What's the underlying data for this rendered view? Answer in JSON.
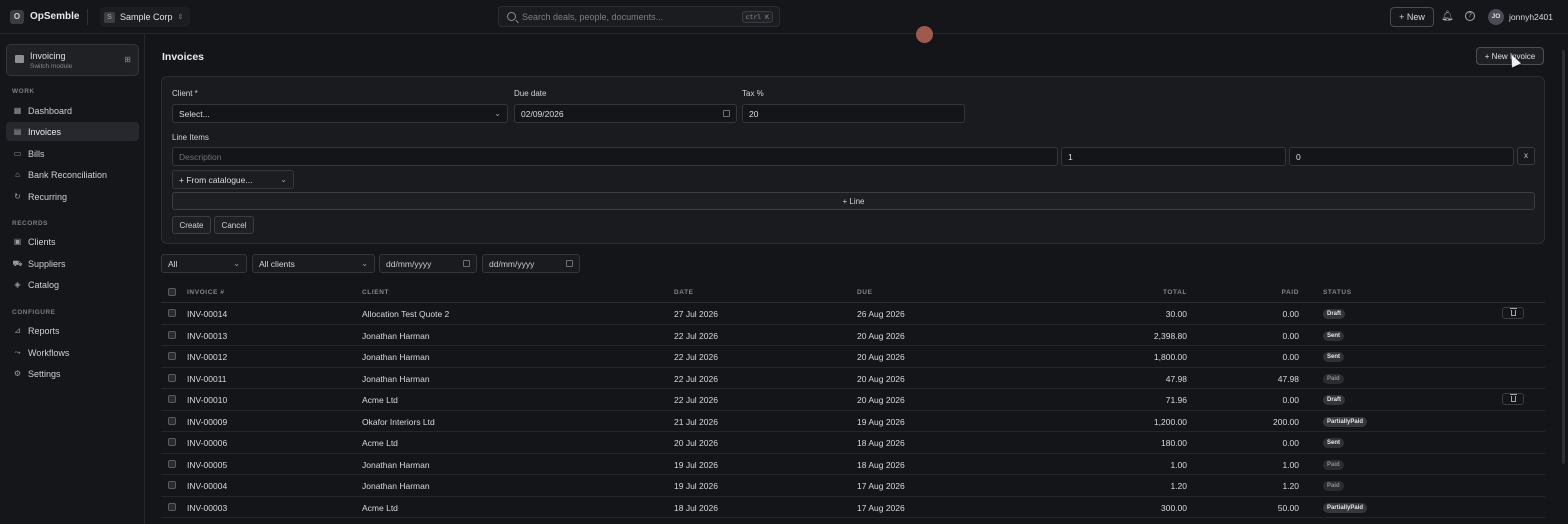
{
  "app": {
    "brand": "OpSemble",
    "logo": "O",
    "org": "Sample Corp",
    "org_icon": "S"
  },
  "search": {
    "placeholder": "Search deals, people, documents...",
    "shortcut": "ctrl K"
  },
  "topbar": {
    "new_label": "+ New",
    "user_initials": "JO",
    "username": "jonnyh2401"
  },
  "module": {
    "title": "Invoicing",
    "subtitle": "Switch module"
  },
  "sidebar": {
    "sections": [
      {
        "label": "WORK",
        "items": [
          {
            "label": "Dashboard",
            "icon": "grid-icon"
          },
          {
            "label": "Invoices",
            "icon": "file-icon",
            "active": true
          },
          {
            "label": "Bills",
            "icon": "receipt-icon"
          },
          {
            "label": "Bank Reconciliation",
            "icon": "bank-icon"
          },
          {
            "label": "Recurring",
            "icon": "repeat-icon"
          }
        ]
      },
      {
        "label": "RECORDS",
        "items": [
          {
            "label": "Clients",
            "icon": "users-icon"
          },
          {
            "label": "Suppliers",
            "icon": "truck-icon"
          },
          {
            "label": "Catalog",
            "icon": "box-icon"
          }
        ]
      },
      {
        "label": "CONFIGURE",
        "items": [
          {
            "label": "Reports",
            "icon": "chart-icon"
          },
          {
            "label": "Workflows",
            "icon": "workflow-icon"
          },
          {
            "label": "Settings",
            "icon": "gear-icon"
          }
        ]
      }
    ]
  },
  "page": {
    "title": "Invoices",
    "new_invoice_label": "+ New Invoice"
  },
  "form": {
    "client_label": "Client *",
    "client_value": "Select...",
    "due_label": "Due date",
    "due_value": "02/09/2026",
    "tax_label": "Tax %",
    "tax_value": "20",
    "line_items_label": "Line Items",
    "description_placeholder": "Description",
    "qty_value": "1",
    "price_value": "0",
    "remove_label": "x",
    "catalogue_label": "+ From catalogue...",
    "add_line_label": "+ Line",
    "create_label": "Create",
    "cancel_label": "Cancel"
  },
  "filters": {
    "status": "All",
    "client": "All clients",
    "from_placeholder": "dd/mm/yyyy",
    "to_placeholder": "dd/mm/yyyy"
  },
  "table": {
    "headers": {
      "invoice": "INVOICE #",
      "client": "CLIENT",
      "date": "DATE",
      "due": "DUE",
      "total": "TOTAL",
      "paid": "PAID",
      "status": "STATUS"
    },
    "rows": [
      {
        "invoice": "INV-00014",
        "client": "Allocation Test Quote 2",
        "date": "27 Jul 2026",
        "due": "26 Aug 2026",
        "total": "30.00",
        "paid": "0.00",
        "status": "Draft",
        "kind": "draft",
        "deletable": true
      },
      {
        "invoice": "INV-00013",
        "client": "Jonathan Harman",
        "date": "22 Jul 2026",
        "due": "20 Aug 2026",
        "total": "2,398.80",
        "paid": "0.00",
        "status": "Sent",
        "kind": "sent"
      },
      {
        "invoice": "INV-00012",
        "client": "Jonathan Harman",
        "date": "22 Jul 2026",
        "due": "20 Aug 2026",
        "total": "1,800.00",
        "paid": "0.00",
        "status": "Sent",
        "kind": "sent"
      },
      {
        "invoice": "INV-00011",
        "client": "Jonathan Harman",
        "date": "22 Jul 2026",
        "due": "20 Aug 2026",
        "total": "47.98",
        "paid": "47.98",
        "status": "Paid",
        "kind": "paid"
      },
      {
        "invoice": "INV-00010",
        "client": "Acme Ltd",
        "date": "22 Jul 2026",
        "due": "20 Aug 2026",
        "total": "71.96",
        "paid": "0.00",
        "status": "Draft",
        "kind": "draft",
        "deletable": true
      },
      {
        "invoice": "INV-00009",
        "client": "Okafor Interiors Ltd",
        "date": "21 Jul 2026",
        "due": "19 Aug 2026",
        "total": "1,200.00",
        "paid": "200.00",
        "status": "PartiallyPaid",
        "kind": "partial"
      },
      {
        "invoice": "INV-00006",
        "client": "Acme Ltd",
        "date": "20 Jul 2026",
        "due": "18 Aug 2026",
        "total": "180.00",
        "paid": "0.00",
        "status": "Sent",
        "kind": "sent"
      },
      {
        "invoice": "INV-00005",
        "client": "Jonathan Harman",
        "date": "19 Jul 2026",
        "due": "18 Aug 2026",
        "total": "1.00",
        "paid": "1.00",
        "status": "Paid",
        "kind": "paid"
      },
      {
        "invoice": "INV-00004",
        "client": "Jonathan Harman",
        "date": "19 Jul 2026",
        "due": "17 Aug 2026",
        "total": "1.20",
        "paid": "1.20",
        "status": "Paid",
        "kind": "paid"
      },
      {
        "invoice": "INV-00003",
        "client": "Acme Ltd",
        "date": "18 Jul 2026",
        "due": "17 Aug 2026",
        "total": "300.00",
        "paid": "50.00",
        "status": "PartiallyPaid",
        "kind": "partial"
      }
    ]
  }
}
